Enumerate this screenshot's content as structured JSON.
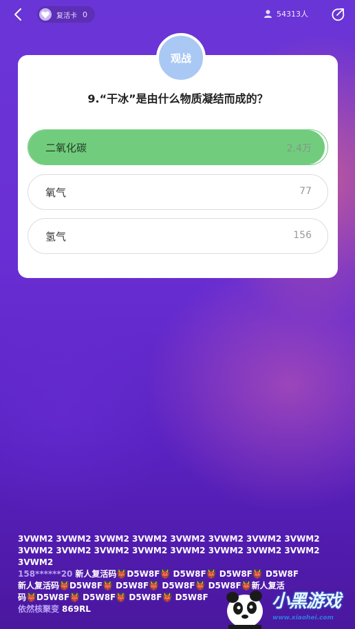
{
  "topbar": {
    "revive_label": "复活卡",
    "revive_count": "0",
    "viewer_count": "54313人"
  },
  "card": {
    "watch_label": "观战",
    "question": "9.“干冰”是由什么物质凝结而成的？",
    "options": [
      {
        "label": "二氧化碳",
        "count": "2.4万",
        "share": 0.99,
        "correct": true
      },
      {
        "label": "氧气",
        "count": "77",
        "share": 0.0,
        "correct": false
      },
      {
        "label": "氢气",
        "count": "156",
        "share": 0.0,
        "correct": false
      }
    ]
  },
  "chat": {
    "lines": [
      "3VWM2 3VWM2 3VWM2 3VWM2 3VWM2 3VWM2 3VWM2 3VWM2",
      "3VWM2 3VWM2 3VWM2 3VWM2 3VWM2 3VWM2 3VWM2 3VWM2",
      "3VWM2"
    ],
    "user1_name": "158******20",
    "user1_msg_line1": "新人复活码👹D5W8F👹 D5W8F👹 D5W8F👹 D5W8F",
    "user1_msg_line2": "新人复活码👹D5W8F👹 D5W8F👹 D5W8F👹 D5W8F👹新人复活",
    "user1_msg_line3": "码👹D5W8F👹 D5W8F👹 D5W8F👹 D5W8F",
    "user2_name": "依然核聚变",
    "user2_msg": "869RL"
  },
  "watermark": {
    "logo_text": "小黑游戏",
    "url": "www.xiaohei.com"
  },
  "colors": {
    "correct_fill": "#72cc7e",
    "watch_circle": "#a9c8f4",
    "chat_name": "#b9a3f5"
  },
  "icons": [
    "back-arrow-icon",
    "heart-icon",
    "person-icon",
    "share-icon",
    "panda-logo-icon"
  ]
}
